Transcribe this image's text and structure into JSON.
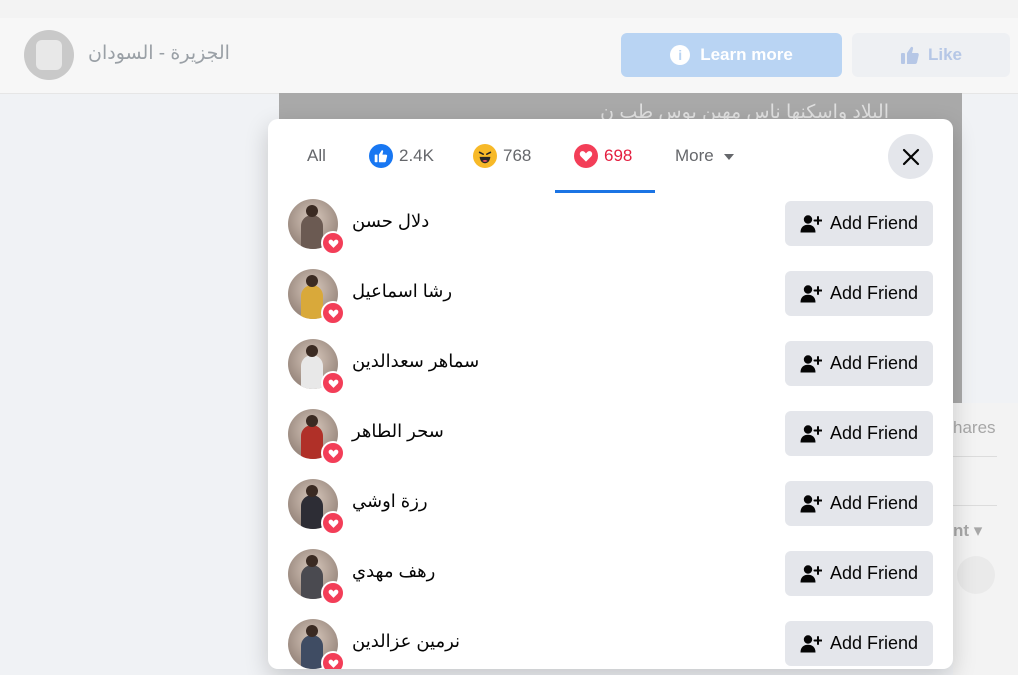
{
  "background": {
    "page_name": "الجزيرة - السودان",
    "learn_more_label": "Learn more",
    "like_label": "Like",
    "media_caption_fragment": "البلاد واسكنها ناس مهين بوس طب ن",
    "shares_fragment": "hares",
    "comment_fragment": "nt"
  },
  "modal": {
    "tabs": [
      {
        "label": "All"
      },
      {
        "icon": "like-reaction-icon",
        "count": "2.4K"
      },
      {
        "icon": "haha-reaction-icon",
        "count": "768"
      },
      {
        "icon": "love-reaction-icon",
        "count": "698",
        "active": true
      },
      {
        "label": "More"
      }
    ],
    "people": [
      {
        "name": "دلال حسن",
        "button": "Add Friend",
        "avatar_color": "#6b5a52"
      },
      {
        "name": "رشا اسماعيل",
        "button": "Add Friend",
        "avatar_color": "#d9a93a"
      },
      {
        "name": "سماهر سعدالدين",
        "button": "Add Friend",
        "avatar_color": "#e8e8e8"
      },
      {
        "name": "سحر الطاهر",
        "button": "Add Friend",
        "avatar_color": "#b03028"
      },
      {
        "name": "رزة اوشي",
        "button": "Add Friend",
        "avatar_color": "#2d2d35"
      },
      {
        "name": "رهف مهدي",
        "button": "Add Friend",
        "avatar_color": "#4a4a50"
      },
      {
        "name": "نرمين عزالدين",
        "button": "Add Friend",
        "avatar_color": "#3f4c63"
      }
    ]
  },
  "colors": {
    "accent_blue": "#1b74e4",
    "love_red": "#e41e3f",
    "button_gray": "#e4e6eb"
  }
}
